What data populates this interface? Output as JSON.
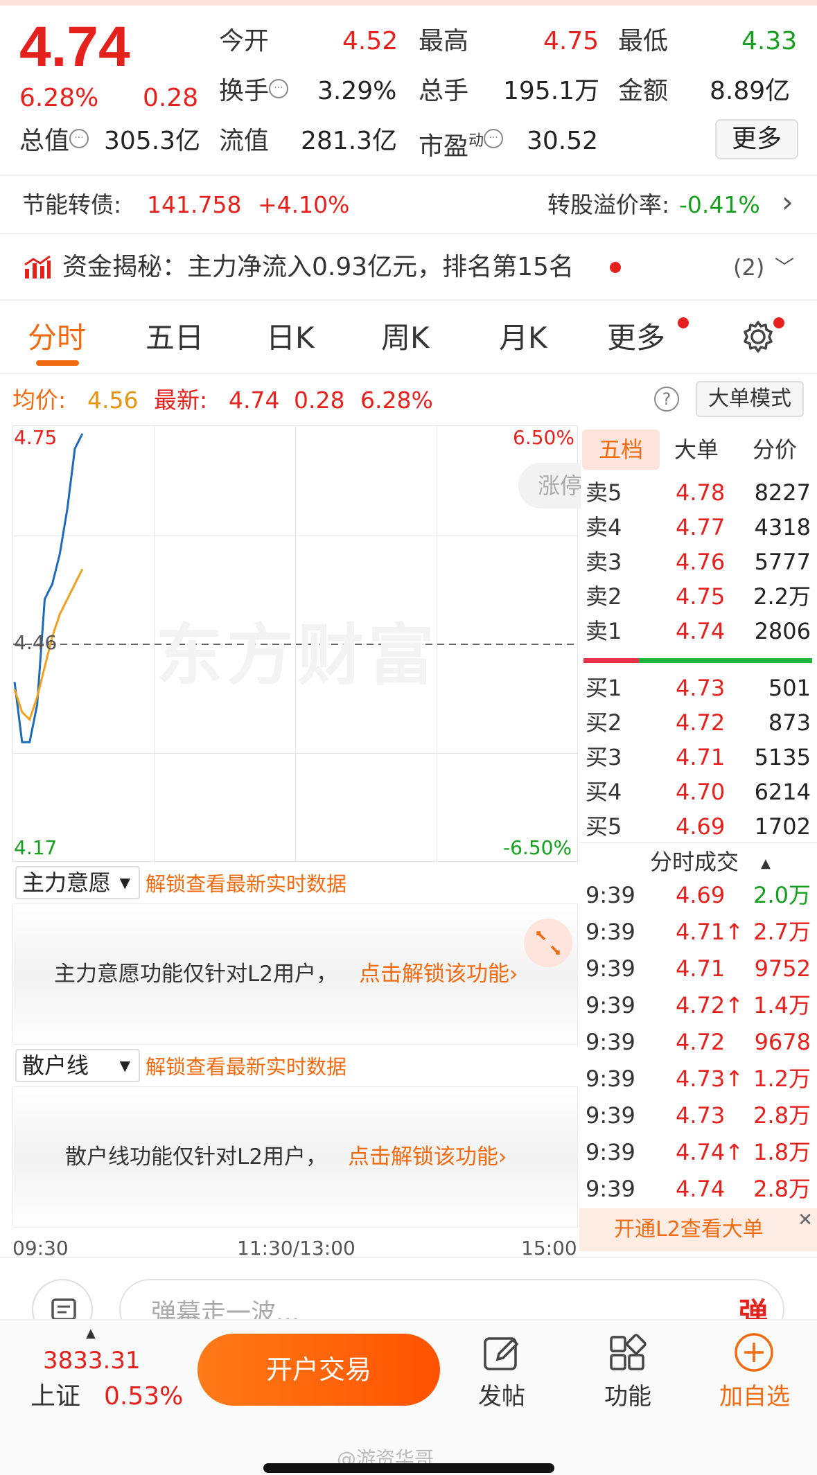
{
  "quote": {
    "price": "4.74",
    "change_pct": "6.28%",
    "change": "0.28",
    "open_label": "今开",
    "open": "4.52",
    "high_label": "最高",
    "high": "4.75",
    "low_label": "最低",
    "low": "4.33",
    "turnover_label": "换手",
    "turnover": "3.29%",
    "volume_label": "总手",
    "volume": "195.1万",
    "amount_label": "金额",
    "amount": "8.89亿",
    "mktcap_label": "总值",
    "mktcap": "305.3亿",
    "float_label": "流值",
    "float": "281.3亿",
    "pe_label": "市盈",
    "pe_sup": "动",
    "pe": "30.52",
    "more_label": "更多",
    "dots_glyph": "···"
  },
  "bond": {
    "label": "节能转债:",
    "price": "141.758",
    "change": "+4.10%",
    "premium_label": "转股溢价率:",
    "premium": "-0.41%",
    "arrow": "›"
  },
  "fund": {
    "text": "资金揭秘：主力净流入0.93亿元，排名第15名",
    "count": "(2)",
    "chevron": "﹀"
  },
  "tabs": [
    {
      "label": "分时"
    },
    {
      "label": "五日"
    },
    {
      "label": "日K"
    },
    {
      "label": "周K"
    },
    {
      "label": "月K"
    },
    {
      "label": "更多"
    }
  ],
  "infobar": {
    "avg_label": "均价:",
    "avg": "4.56",
    "last_label": "最新:",
    "last": "4.74",
    "change": "0.28",
    "change_pct": "6.28%",
    "help": "?",
    "mode_btn": "大单模式"
  },
  "chart": {
    "y_top": "4.75",
    "y_mid": "4.46",
    "y_bottom": "4.17",
    "pct_top": "6.50%",
    "pct_bottom": "-6.50%",
    "x_start": "09:30",
    "x_mid": "11:30/13:00",
    "x_end": "15:00",
    "watermark": "东方财富",
    "limit_label": "涨停",
    "colors": {
      "price_line": "#1d6bb8",
      "avg_line": "#f0a020"
    }
  },
  "chart_data": {
    "type": "line",
    "x": [
      "09:30",
      "09:31",
      "09:32",
      "09:33",
      "09:34",
      "09:35",
      "09:36",
      "09:37",
      "09:38",
      "09:39"
    ],
    "series": [
      {
        "values": [
          4.41,
          4.33,
          4.33,
          4.38,
          4.52,
          4.54,
          4.58,
          4.64,
          4.72,
          4.74
        ]
      },
      {
        "values": [
          4.4,
          4.37,
          4.36,
          4.39,
          4.43,
          4.47,
          4.5,
          4.52,
          4.54,
          4.56
        ]
      }
    ],
    "ylim": [
      4.17,
      4.75
    ],
    "ref_line": 4.46
  },
  "panels": [
    {
      "dropdown": "主力意愿",
      "unlock_hint": "解锁查看最新实时数据",
      "message": "主力意愿功能仅针对L2用户，",
      "link": "点击解锁该功能›"
    },
    {
      "dropdown": "散户线",
      "unlock_hint": "解锁查看最新实时数据",
      "message": "散户线功能仅针对L2用户，",
      "link": "点击解锁该功能›"
    }
  ],
  "orderbook": {
    "tabs": [
      "五档",
      "大单",
      "分价"
    ],
    "asks": [
      {
        "label": "卖5",
        "price": "4.78",
        "vol": "8227"
      },
      {
        "label": "卖4",
        "price": "4.77",
        "vol": "4318"
      },
      {
        "label": "卖3",
        "price": "4.76",
        "vol": "5777"
      },
      {
        "label": "卖2",
        "price": "4.75",
        "vol": "2.2万"
      },
      {
        "label": "卖1",
        "price": "4.74",
        "vol": "2806"
      }
    ],
    "bids": [
      {
        "label": "买1",
        "price": "4.73",
        "vol": "501"
      },
      {
        "label": "买2",
        "price": "4.72",
        "vol": "873"
      },
      {
        "label": "买3",
        "price": "4.71",
        "vol": "5135"
      },
      {
        "label": "买4",
        "price": "4.70",
        "vol": "6214"
      },
      {
        "label": "买5",
        "price": "4.69",
        "vol": "1702"
      }
    ],
    "balance": {
      "colors": {
        "buy": "#e5211d",
        "sell": "#14a01e"
      }
    }
  },
  "ticks": {
    "header": "分时成交",
    "rows": [
      {
        "time": "9:39",
        "price": "4.69",
        "vol": "2.0万",
        "vol_color": "green"
      },
      {
        "time": "9:39",
        "price": "4.71↑",
        "vol": "2.7万",
        "vol_color": "red"
      },
      {
        "time": "9:39",
        "price": "4.71",
        "vol": "9752",
        "vol_color": "red"
      },
      {
        "time": "9:39",
        "price": "4.72↑",
        "vol": "1.4万",
        "vol_color": "red"
      },
      {
        "time": "9:39",
        "price": "4.72",
        "vol": "9678",
        "vol_color": "red"
      },
      {
        "time": "9:39",
        "price": "4.73↑",
        "vol": "1.2万",
        "vol_color": "red"
      },
      {
        "time": "9:39",
        "price": "4.73",
        "vol": "2.8万",
        "vol_color": "red"
      },
      {
        "time": "9:39",
        "price": "4.74↑",
        "vol": "1.8万",
        "vol_color": "red"
      },
      {
        "time": "9:39",
        "price": "4.74",
        "vol": "2.8万",
        "vol_color": "red"
      }
    ],
    "l2_banner": "开通L2查看大单",
    "close_glyph": "✕"
  },
  "danmaku": {
    "placeholder": "弹幕走一波...",
    "send": "弹"
  },
  "bottom": {
    "index_value": "3833.31",
    "index_name": "上证",
    "index_pct": "0.53%",
    "trade_btn": "开户交易",
    "post": "发帖",
    "func": "功能",
    "watch": "加自选"
  },
  "footer": {
    "credit": "@游资华哥"
  }
}
